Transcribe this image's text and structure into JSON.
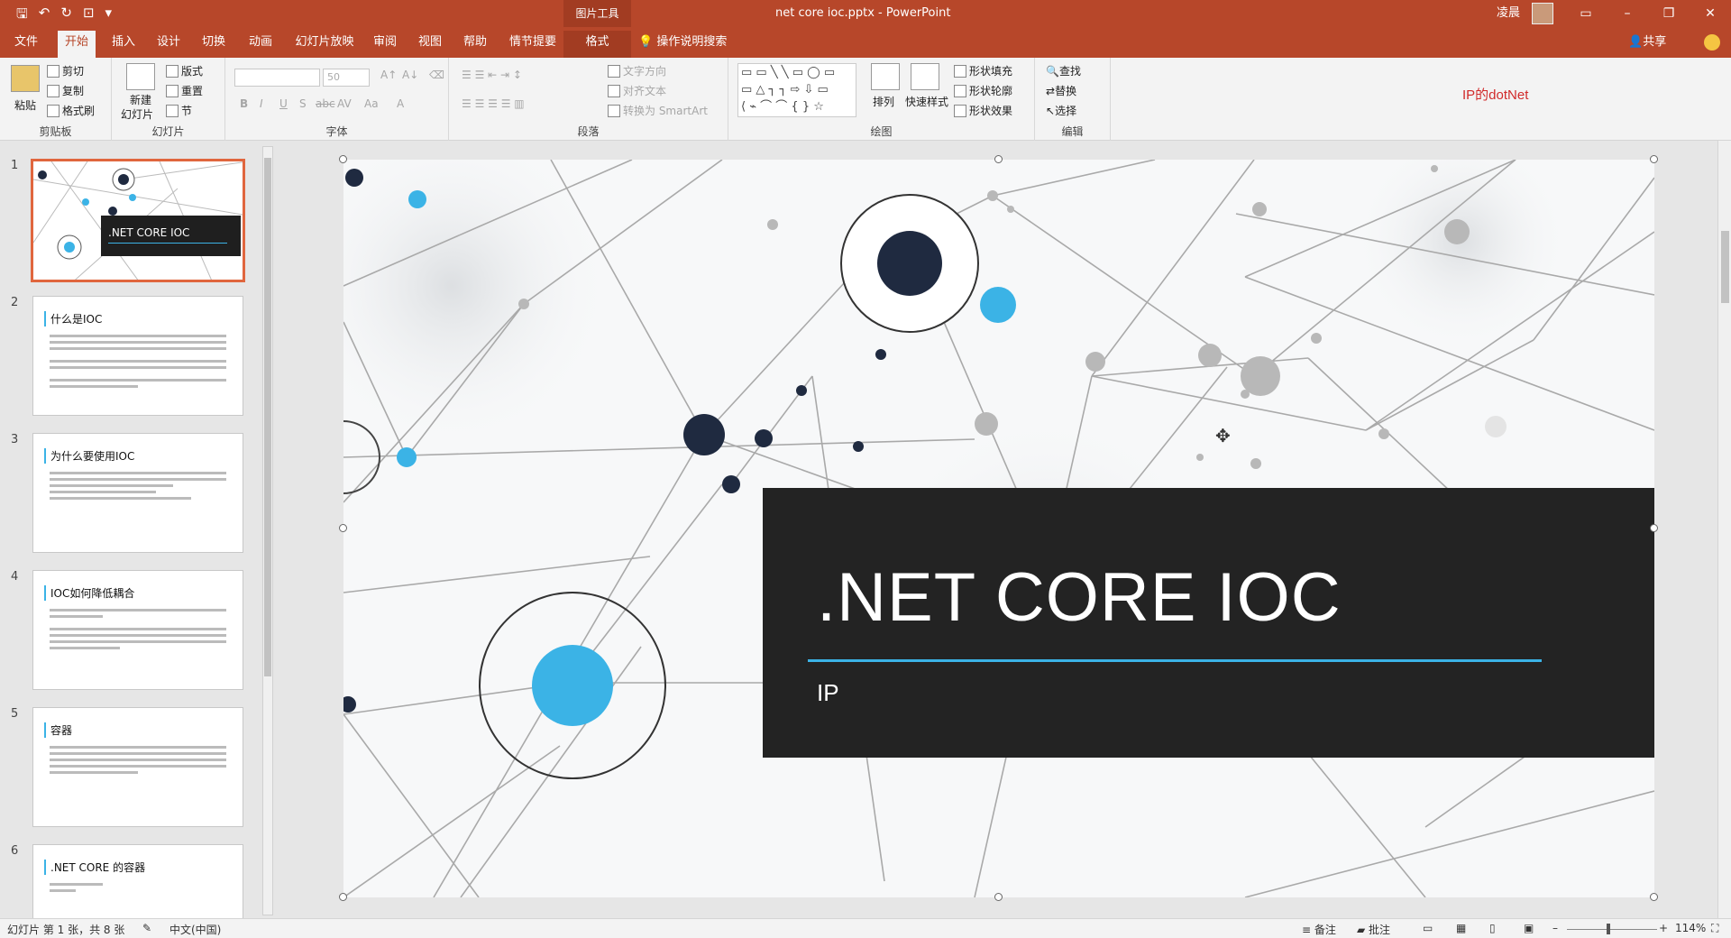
{
  "titlebar": {
    "context_tools": "图片工具",
    "doc_title": "net core ioc.pptx  -  PowerPoint",
    "user": "凌晨",
    "minimize": "–",
    "restore": "❐",
    "close": "✕",
    "ribbon_display": "▭"
  },
  "tabs": {
    "file": "文件",
    "home": "开始",
    "insert": "插入",
    "design": "设计",
    "transitions": "切换",
    "animations": "动画",
    "slideshow": "幻灯片放映",
    "review": "审阅",
    "view": "视图",
    "help": "帮助",
    "storyboard": "情节提要",
    "format": "格式",
    "tell_me": "操作说明搜索",
    "share": "共享"
  },
  "ribbon": {
    "clipboard": {
      "label": "剪贴板",
      "paste": "粘贴",
      "cut": "剪切",
      "copy": "复制",
      "format_painter": "格式刷"
    },
    "slides": {
      "label": "幻灯片",
      "new_slide": "新建",
      "new_slide2": "幻灯片",
      "layout": "版式",
      "reset": "重置",
      "section": "节"
    },
    "font": {
      "label": "字体",
      "size": "50",
      "bold": "B",
      "italic": "I",
      "underline": "U",
      "shadow": "S",
      "strike": "abc",
      "spacing": "AV",
      "case": "Aa",
      "color": "A"
    },
    "paragraph": {
      "label": "段落",
      "text_direction": "文字方向",
      "align_text": "对齐文本",
      "smartart": "转换为 SmartArt"
    },
    "drawing": {
      "label": "绘图",
      "arrange": "排列",
      "quick_styles": "快速样式",
      "shape_fill": "形状填充",
      "shape_outline": "形状轮廓",
      "shape_effects": "形状效果"
    },
    "editing": {
      "label": "编辑",
      "find": "查找",
      "replace": "替换",
      "select": "选择"
    }
  },
  "watermark_logo": "IP的dotNet",
  "thumbnails": [
    {
      "num": "1",
      "title": ".NET CORE IOC",
      "subtitle": "IP"
    },
    {
      "num": "2",
      "title": "什么是IOC"
    },
    {
      "num": "3",
      "title": "为什么要使用IOC"
    },
    {
      "num": "4",
      "title": "IOC如何降低耦合"
    },
    {
      "num": "5",
      "title": "容器"
    },
    {
      "num": "6",
      "title": ".NET CORE 的容器"
    }
  ],
  "slide": {
    "title": ".NET CORE IOC",
    "subtitle": "IP"
  },
  "colors": {
    "accent": "#b7472a",
    "cyan": "#3bb3e6",
    "navy": "#1f2a40",
    "title_box": "#232323"
  },
  "status": {
    "slide_info": "幻灯片 第 1 张，共 8 张",
    "language": "中文(中国)",
    "notes": "备注",
    "comments": "批注",
    "zoom": "114%"
  }
}
